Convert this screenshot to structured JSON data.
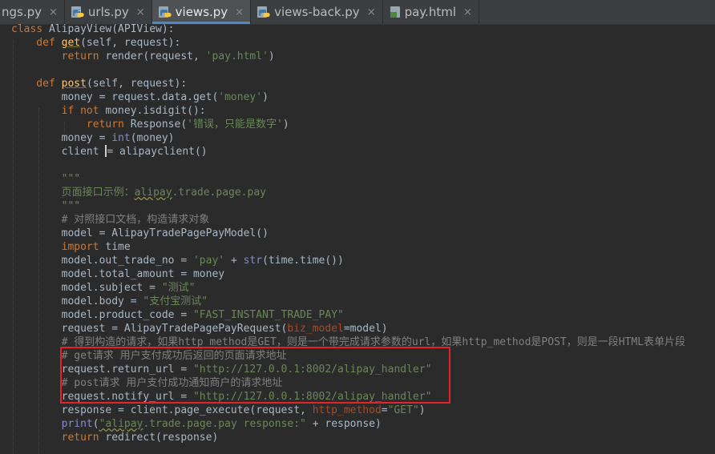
{
  "tabs": [
    {
      "label": "ngs.py",
      "icon": "python-file-icon",
      "active": false
    },
    {
      "label": "urls.py",
      "icon": "python-file-icon",
      "active": false
    },
    {
      "label": "views.py",
      "icon": "python-file-icon",
      "active": true
    },
    {
      "label": "views-back.py",
      "icon": "python-file-icon",
      "active": false
    },
    {
      "label": "pay.html",
      "icon": "html-file-icon",
      "active": false
    }
  ],
  "close_glyph": "×",
  "code": {
    "l1a": "class ",
    "l1b": "AlipayView(APIView):",
    "l2a": "    def ",
    "l2b": "get",
    "l2c": "(self, request):",
    "l3a": "        return ",
    "l3b": "render(request, ",
    "l3c": "'pay.html'",
    "l3d": ")",
    "l5a": "    def ",
    "l5b": "post",
    "l5c": "(self, request):",
    "l6a": "        money = request.data.get(",
    "l6b": "'money'",
    "l6c": ")",
    "l7a": "        if not ",
    "l7b": "money.isdigit():",
    "l8a": "            return ",
    "l8b": "Response(",
    "l8c": "'错误，只能是数字'",
    "l8d": ")",
    "l9a": "        money = ",
    "l9b": "int",
    "l9c": "(money)",
    "l10a": "        client ",
    "l10b": "= alipayclient()",
    "l12": "        \"\"\"",
    "l13a": "        页面接口示例：",
    "l13b": "alipay",
    "l13c": ".trade.page.pay",
    "l14": "        \"\"\"",
    "l15": "        # 对照接口文档，构造请求对象",
    "l16": "        model = AlipayTradePagePayModel()",
    "l17a": "        import ",
    "l17b": "time",
    "l18a": "        model.out_trade_no = ",
    "l18b": "'pay'",
    "l18c": " + ",
    "l18d": "str",
    "l18e": "(time.time())",
    "l19": "        model.total_amount = money",
    "l20a": "        model.subject = ",
    "l20b": "\"测试\"",
    "l21a": "        model.body = ",
    "l21b": "\"支付宝测试\"",
    "l22a": "        model.product_code = ",
    "l22b": "\"FAST_INSTANT_TRADE_PAY\"",
    "l23a": "        request = AlipayTradePagePayRequest(",
    "l23b": "biz_model",
    "l23c": "=model)",
    "l24": "        # 得到构造的请求，如果http_method是GET，则是一个带完成请求参数的url，如果http_method是POST，则是一段HTML表单片段",
    "l25": "        # get请求 用户支付成功后返回的页面请求地址",
    "l26a": "        request.return_url = ",
    "l26b": "\"http://127.0.0.1:8002/alipay_handler\"",
    "l27": "        # post请求 用户支付成功通知商户的请求地址",
    "l28a": "        request.notify_url = ",
    "l28b": "\"http://127.0.0.1:8002/alipay_handler\"",
    "l29a": "        response = client.page_execute(request, ",
    "l29b": "http_method",
    "l29c": "=",
    "l29d": "\"GET\"",
    "l29e": ")",
    "l30a": "        ",
    "l30b": "print",
    "l30c": "(",
    "l30d": "\"alipay",
    "l30e": ".trade.page.pay response:\"",
    "l30f": " + response)",
    "l31a": "        return ",
    "l31b": "redirect(response)"
  },
  "colors": {
    "background": "#2b2b2b",
    "keyword": "#cc7832",
    "string": "#6a8759",
    "comment": "#808080",
    "function": "#ffc66d",
    "highlight_box": "#e8202a",
    "active_tab_underline": "#4a88c7"
  }
}
